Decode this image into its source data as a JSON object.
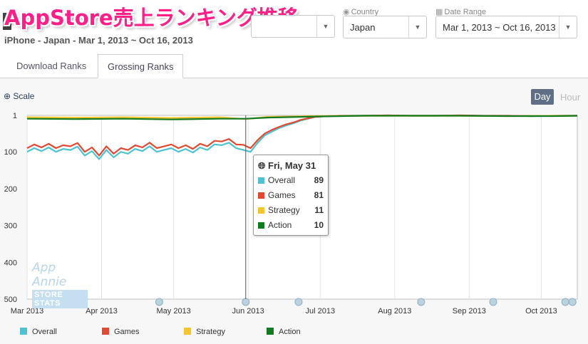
{
  "header": {
    "title": "AppStore売上ランキング推移",
    "subtitle": "iPhone - Japan - Mar 1, 2013 ~ Oct 16, 2013"
  },
  "filters": {
    "country_label": "Country",
    "country_value": "Japan",
    "date_label": "Date Range",
    "date_value": "Mar 1, 2013 ~ Oct 16, 2013"
  },
  "tabs": [
    {
      "label": "Download Ranks",
      "active": false
    },
    {
      "label": "Grossing Ranks",
      "active": true
    }
  ],
  "toolbar": {
    "scale_label": "Scale",
    "day_label": "Day",
    "hour_label": "Hour"
  },
  "watermark": {
    "line1": "App Annie",
    "line2": "STORE STATS"
  },
  "tooltip": {
    "date": "Fri, May 31",
    "rows": [
      {
        "name": "Overall",
        "value": "89",
        "color": "#4fc1d1"
      },
      {
        "name": "Games",
        "value": "81",
        "color": "#e04a32"
      },
      {
        "name": "Strategy",
        "value": "11",
        "color": "#f5c431"
      },
      {
        "name": "Action",
        "value": "10",
        "color": "#127a20"
      }
    ]
  },
  "legend": [
    {
      "name": "Overall",
      "color": "#4fc1d1"
    },
    {
      "name": "Games",
      "color": "#e04a32"
    },
    {
      "name": "Strategy",
      "color": "#f5c431"
    },
    {
      "name": "Action",
      "color": "#127a20"
    }
  ],
  "chart_data": {
    "type": "line",
    "y_reversed": true,
    "ylim": [
      1,
      500
    ],
    "y_ticks": [
      "1",
      "100",
      "200",
      "300",
      "400",
      "500"
    ],
    "y_tick_values": [
      1,
      100,
      200,
      300,
      400,
      500
    ],
    "x_ticks": [
      "Mar 2013",
      "Apr 2013",
      "May 2013",
      "Jun 2013",
      "Jul 2013",
      "Aug 2013",
      "Sep 2013",
      "Oct 2013"
    ],
    "x_tick_days": [
      0,
      31,
      61,
      92,
      122,
      153,
      184,
      214
    ],
    "x_range_days": [
      0,
      229
    ],
    "crosshair_day": 91,
    "series": [
      {
        "name": "Overall",
        "color": "#4fc1d1",
        "x": [
          0,
          3,
          6,
          9,
          12,
          15,
          18,
          21,
          24,
          27,
          30,
          33,
          36,
          39,
          42,
          45,
          48,
          51,
          54,
          57,
          60,
          63,
          66,
          69,
          72,
          75,
          78,
          81,
          84,
          87,
          90,
          93,
          96,
          99,
          102,
          105,
          108,
          111,
          114,
          117,
          120,
          125,
          130,
          140,
          150,
          160,
          170,
          180,
          190,
          200,
          210,
          220,
          229
        ],
        "y": [
          100,
          90,
          98,
          88,
          100,
          92,
          95,
          86,
          110,
          98,
          120,
          95,
          115,
          100,
          105,
          92,
          98,
          85,
          100,
          95,
          90,
          100,
          92,
          102,
          88,
          95,
          80,
          82,
          75,
          90,
          95,
          100,
          75,
          55,
          45,
          35,
          28,
          22,
          15,
          10,
          5,
          3,
          2,
          2,
          1,
          2,
          2,
          1,
          2,
          2,
          3,
          2,
          2
        ]
      },
      {
        "name": "Games",
        "color": "#e04a32",
        "x": [
          0,
          3,
          6,
          9,
          12,
          15,
          18,
          21,
          24,
          27,
          30,
          33,
          36,
          39,
          42,
          45,
          48,
          51,
          54,
          57,
          60,
          63,
          66,
          69,
          72,
          75,
          78,
          81,
          84,
          87,
          90,
          93,
          96,
          99,
          102,
          105,
          108,
          111,
          114,
          117,
          120,
          125,
          130,
          140,
          150,
          160,
          170,
          180,
          190,
          200,
          210,
          220,
          229
        ],
        "y": [
          90,
          80,
          88,
          78,
          90,
          82,
          85,
          76,
          100,
          88,
          110,
          85,
          105,
          90,
          95,
          82,
          88,
          75,
          90,
          85,
          80,
          90,
          82,
          92,
          78,
          85,
          70,
          72,
          65,
          80,
          81,
          90,
          68,
          50,
          40,
          32,
          25,
          20,
          13,
          9,
          5,
          3,
          2,
          2,
          1,
          2,
          2,
          1,
          2,
          2,
          3,
          2,
          2
        ]
      },
      {
        "name": "Strategy",
        "color": "#f5c431",
        "x": [
          0,
          20,
          40,
          60,
          80,
          91,
          100,
          120,
          140,
          160,
          180,
          200,
          220,
          229
        ],
        "y": [
          6,
          7,
          6,
          8,
          6,
          11,
          5,
          3,
          2,
          2,
          2,
          3,
          2,
          2
        ]
      },
      {
        "name": "Action",
        "color": "#127a20",
        "x": [
          0,
          20,
          40,
          60,
          80,
          91,
          100,
          120,
          140,
          160,
          180,
          200,
          220,
          229
        ],
        "y": [
          10,
          11,
          10,
          12,
          10,
          10,
          7,
          4,
          2,
          2,
          2,
          3,
          3,
          2
        ]
      }
    ]
  }
}
